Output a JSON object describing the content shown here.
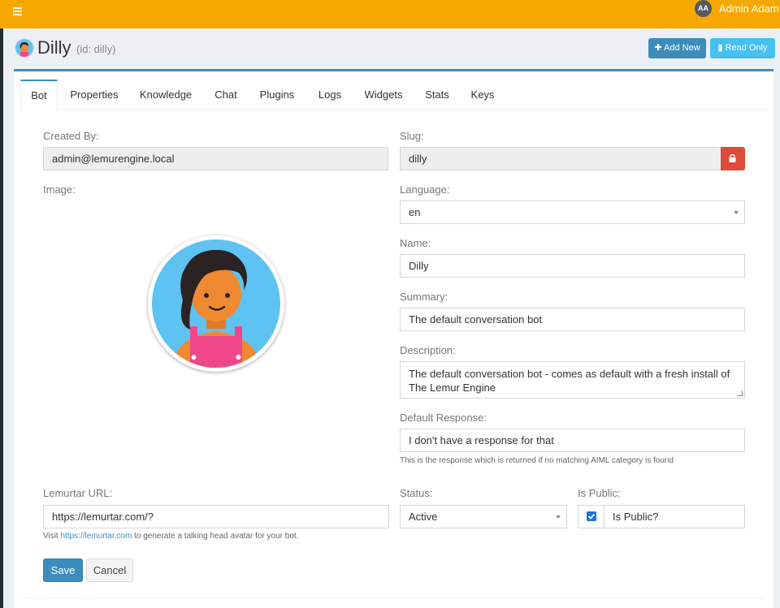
{
  "topbar": {
    "menu_icon": "hamburger-icon",
    "user_initials": "AA",
    "user_name": "Admin Adam"
  },
  "header": {
    "title": "Dilly",
    "subtitle": "(id: dilly)",
    "add_new_label": "Add New",
    "read_only_label": "Read Only"
  },
  "tabs": [
    "Bot",
    "Properties",
    "Knowledge",
    "Chat",
    "Plugins",
    "Logs",
    "Widgets",
    "Stats",
    "Keys"
  ],
  "form": {
    "created_by_label": "Created By:",
    "created_by_value": "admin@lemurengine.local",
    "slug_label": "Slug:",
    "slug_value": "dilly",
    "image_label": "Image:",
    "language_label": "Language:",
    "language_value": "en",
    "name_label": "Name:",
    "name_value": "Dilly",
    "summary_label": "Summary:",
    "summary_value": "The default conversation bot",
    "description_label": "Description:",
    "description_value": "The default conversation bot - comes as default with a fresh install of The Lemur Engine",
    "default_response_label": "Default Response:",
    "default_response_value": "I don't have a response for that",
    "default_response_help": "This is the response which is returned if no matching AIML category is found",
    "lemurtar_label": "Lemurtar URL:",
    "lemurtar_value": "https://lemurtar.com/?",
    "lemurtar_help_pre": "Visit ",
    "lemurtar_help_link": "https://lemurtar.com",
    "lemurtar_help_post": " to generate a talking head avatar for your bot.",
    "status_label": "Status:",
    "status_value": "Active",
    "is_public_label": "Is Public:",
    "is_public_checkbox_label": "Is Public?",
    "is_public_checked": true
  },
  "actions": {
    "save_label": "Save",
    "cancel_label": "Cancel"
  },
  "colors": {
    "topbar": "#f7a800",
    "primary": "#3c8dbc",
    "info": "#45c0f0",
    "danger": "#dd4b39"
  }
}
